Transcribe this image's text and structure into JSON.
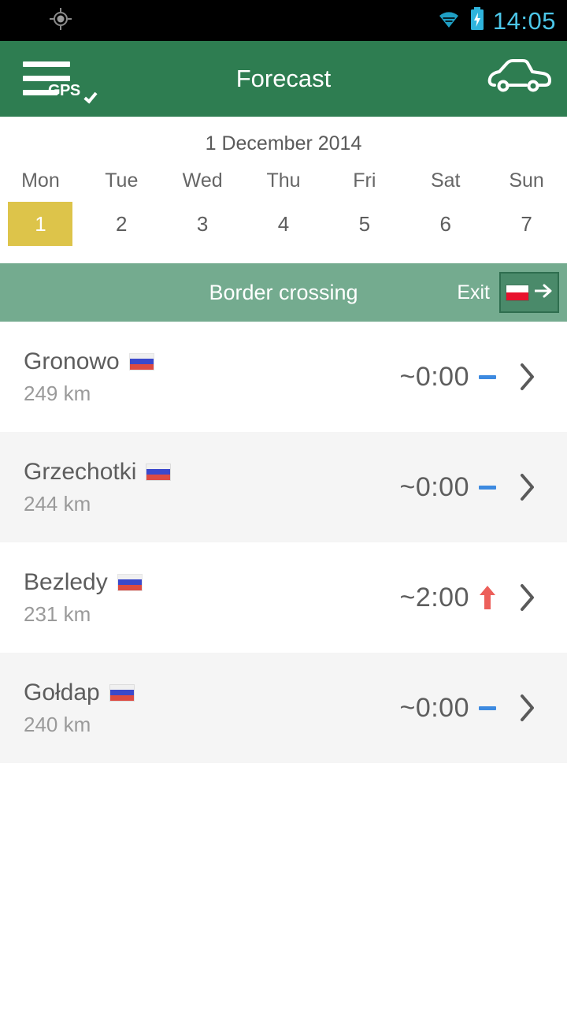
{
  "statusbar": {
    "time": "14:05",
    "icons": [
      "gps-crosshair-icon",
      "wifi-icon",
      "battery-charging-icon"
    ]
  },
  "toolbar": {
    "title": "Forecast",
    "menu_label": "GPS",
    "menu_icon": "hamburger-gps-icon",
    "right_icon": "car-icon",
    "color": "#2e7d51"
  },
  "calendar": {
    "date_title": "1 December 2014",
    "day_names": [
      "Mon",
      "Tue",
      "Wed",
      "Thu",
      "Fri",
      "Sat",
      "Sun"
    ],
    "day_numbers": [
      "1",
      "2",
      "3",
      "4",
      "5",
      "6",
      "7"
    ],
    "selected_index": 0,
    "selected_color": "#ddc44a"
  },
  "section": {
    "title": "Border crossing",
    "exit_label": "Exit",
    "exit_flag": "poland-flag-icon",
    "exit_arrow": "arrow-right-icon",
    "color": "#74ab8f"
  },
  "crossings": [
    {
      "name": "Gronowo",
      "flag": "russia-flag-icon",
      "distance": "249 km",
      "wait": "~0:00",
      "trend": "flat",
      "trend_color": "#3d8ae0"
    },
    {
      "name": "Grzechotki",
      "flag": "russia-flag-icon",
      "distance": "244 km",
      "wait": "~0:00",
      "trend": "flat",
      "trend_color": "#3d8ae0"
    },
    {
      "name": "Bezledy",
      "flag": "russia-flag-icon",
      "distance": "231 km",
      "wait": "~2:00",
      "trend": "up",
      "trend_color": "#ec5f5a"
    },
    {
      "name": "Gołdap",
      "flag": "russia-flag-icon",
      "distance": "240 km",
      "wait": "~0:00",
      "trend": "flat",
      "trend_color": "#3d8ae0"
    }
  ]
}
